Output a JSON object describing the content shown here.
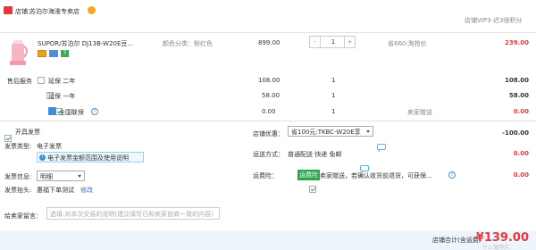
{
  "header": {
    "shop_label": "店铺：",
    "shop_name": "苏泊尔海淮专卖店",
    "shop_rating": "店铺VIP3-迟3倍积分"
  },
  "product": {
    "title": "SUPOR/苏泊尔 DJ13B-W20E豆...",
    "spec_label": "颜色分类：粉红色",
    "unit_price": "899.00",
    "quantity": "1",
    "save_note": "省660:淘抢价",
    "subtotal": "239.00",
    "minus_label": "-",
    "plus_label": "+"
  },
  "services": {
    "label": "售后服务",
    "items": [
      {
        "name": "延保 二年",
        "price": "108.00",
        "qty": "1",
        "note": "",
        "amount": "108.00",
        "checked": false
      },
      {
        "name": "延保 一年",
        "price": "58.00",
        "qty": "1",
        "note": "",
        "amount": "58.00",
        "checked": false
      },
      {
        "name": "全国联保",
        "price": "0.00",
        "qty": "1",
        "note": "卖家赠送",
        "amount": "0.00",
        "checked": true
      }
    ]
  },
  "invoice": {
    "open_label": "开具发票",
    "type_label": "发票类型:",
    "type_value": "电子发票",
    "type_notice": "电子发票金额范围及使用说明",
    "info_label": "发票信息:",
    "info_value": "明细",
    "title_label": "发票抬头:",
    "title_value": "惠福下单测试",
    "edit_label": "修改"
  },
  "coupon": {
    "label": "店铺优惠：",
    "value": "省100元:TKBC-W20E享",
    "amount": "-100.00"
  },
  "shipping": {
    "label": "运送方式：",
    "method": "普通配送 快递 免邮",
    "amount": "0.00"
  },
  "insurance": {
    "label": "运费险：",
    "badge": "运费险",
    "text": "卖家赠送，若确认收货前退货，可获保...",
    "amount": "0.00"
  },
  "message": {
    "label": "给卖家留言：",
    "placeholder": "选填:对本次交易的说明(建议填写已和卖家协商一致的内容)"
  },
  "total": {
    "label": "店铺合计(含运费)",
    "value": "¥139.00"
  },
  "watermark": "什么值得买"
}
